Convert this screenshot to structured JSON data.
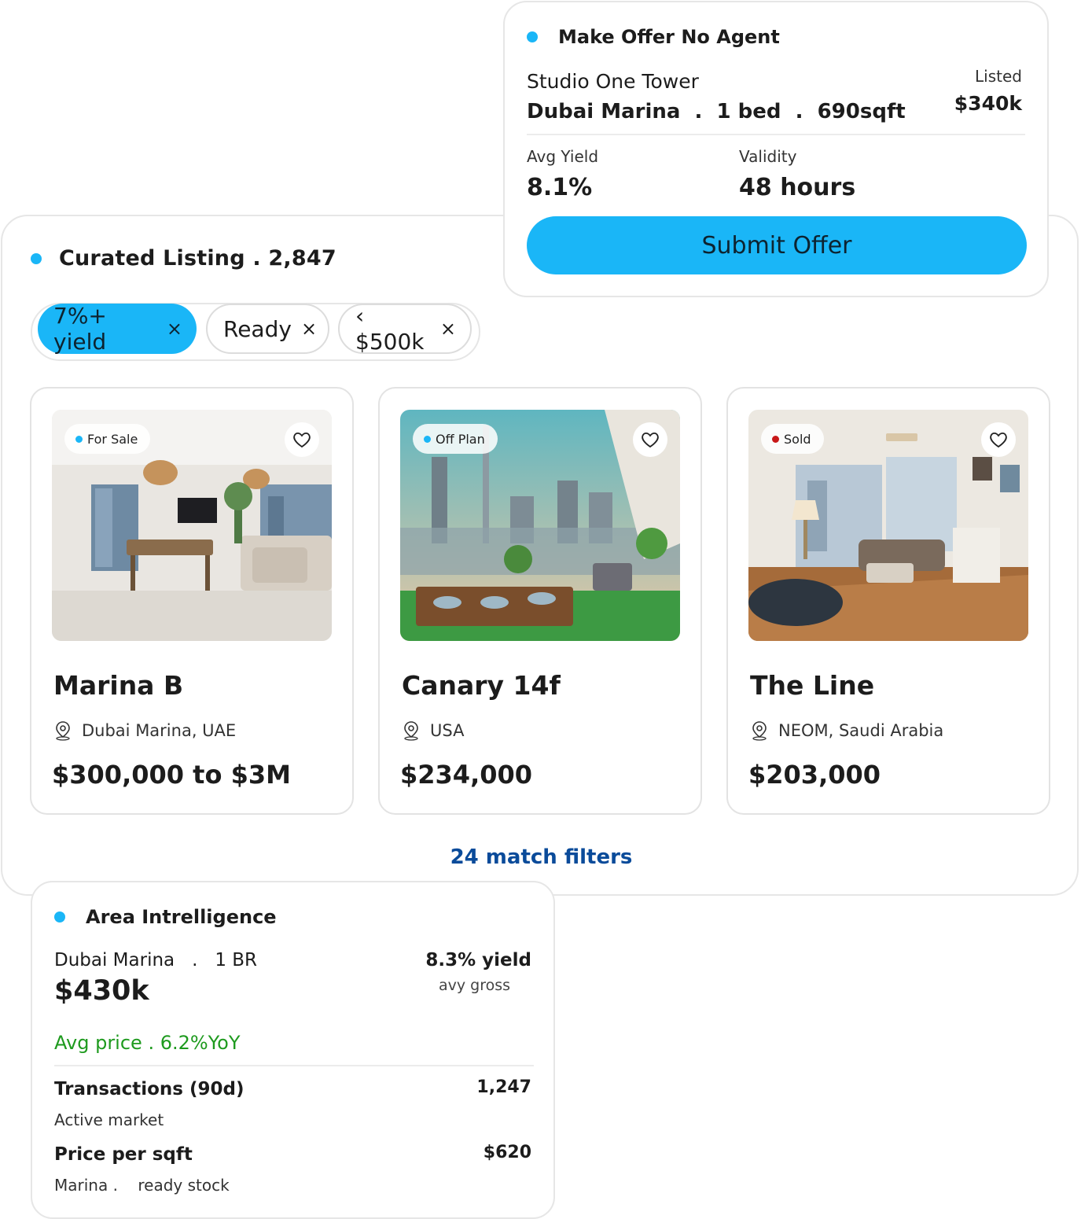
{
  "curated": {
    "title": "Curated Listing . 2,847",
    "filters": [
      {
        "label": "7%+ yield",
        "remove": "×"
      },
      {
        "label": "Ready",
        "remove": "×"
      },
      {
        "label": "‹ $500k",
        "remove": "×"
      }
    ],
    "listings": [
      {
        "badge": "For Sale",
        "badge_color": "#1ab6f7",
        "title": "Marina B",
        "location": "Dubai Marina, UAE",
        "price": "$300,000 to $3M"
      },
      {
        "badge": "Off Plan",
        "badge_color": "#1ab6f7",
        "title": "Canary 14f",
        "location": "USA",
        "price": "$234,000"
      },
      {
        "badge": "Sold",
        "badge_color": "#c81818",
        "title": "The Line",
        "location": "NEOM, Saudi Arabia",
        "price": "$203,000"
      }
    ],
    "match_text": "24 match filters"
  },
  "offer": {
    "title": "Make Offer No Agent",
    "property": "Studio One Tower",
    "details": "Dubai Marina  .  1 bed  .  690sqft",
    "listed_label": "Listed",
    "listed_value": "$340k",
    "yield_label": "Avg Yield",
    "yield_value": "8.1%",
    "validity_label": "Validity",
    "validity_value": "48 hours",
    "submit_label": "Submit Offer"
  },
  "area": {
    "title": "Area Intrelligence",
    "location": "Dubai Marina   .   1 BR",
    "price": "$430k",
    "yield": "8.3% yield",
    "yield_sub": "avy gross",
    "trend": "Avg price . 6.2%YoY",
    "rows": [
      {
        "label": "Transactions (90d)",
        "sub": "Active market",
        "value": "1,247"
      },
      {
        "label": "Price per sqft",
        "sub": "Marina .    ready stock",
        "value": "$620"
      }
    ]
  },
  "colors": {
    "accent": "#1ab6f7",
    "link": "#0a4b9a",
    "positive": "#1e9a1e",
    "sold": "#c81818"
  }
}
